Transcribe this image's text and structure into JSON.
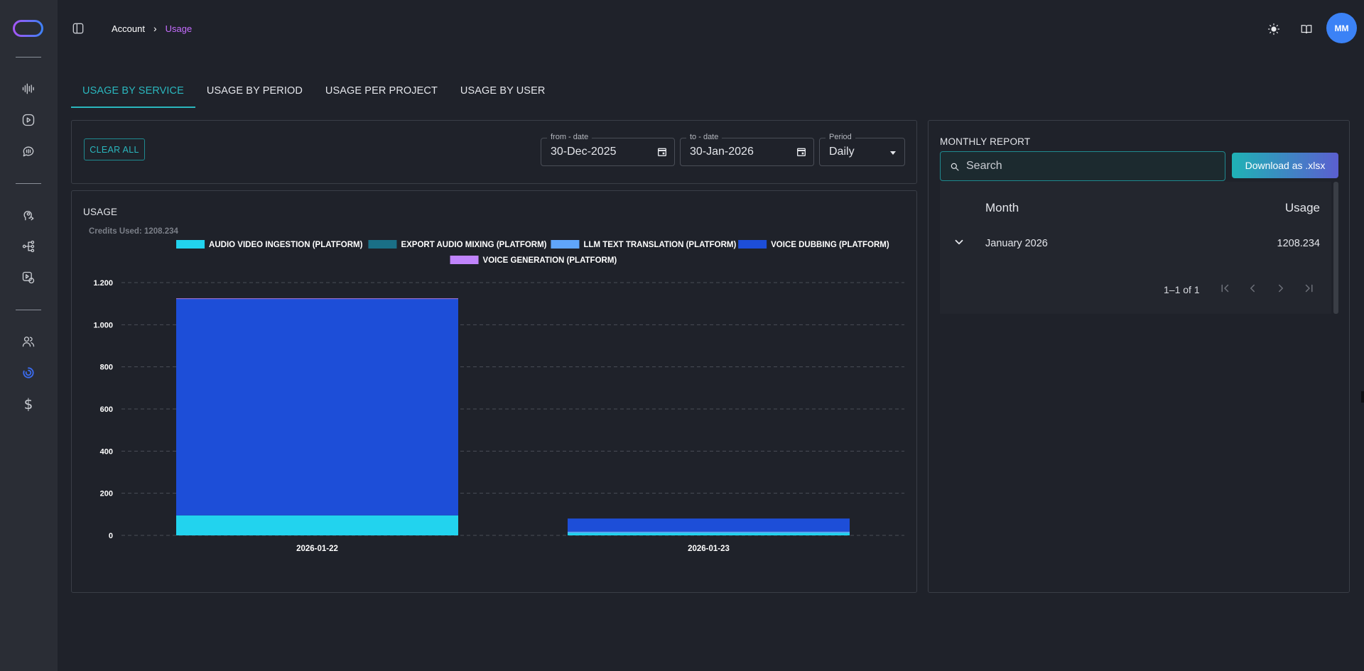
{
  "breadcrumb": {
    "account": "Account",
    "current": "Usage"
  },
  "user": {
    "initials": "MM"
  },
  "tabs": [
    {
      "label": "USAGE BY SERVICE",
      "active": true
    },
    {
      "label": "USAGE BY PERIOD",
      "active": false
    },
    {
      "label": "USAGE PER PROJECT",
      "active": false
    },
    {
      "label": "USAGE BY USER",
      "active": false
    }
  ],
  "filters": {
    "clear_label": "CLEAR ALL",
    "from_label": "from - date",
    "from_value": "30-Dec-2025",
    "to_label": "to - date",
    "to_value": "30-Jan-2026",
    "period_label": "Period",
    "period_value": "Daily"
  },
  "usage": {
    "title": "USAGE",
    "credits": "Credits Used: 1208.234"
  },
  "chart_data": {
    "type": "bar",
    "stacked": true,
    "title": "",
    "xlabel": "",
    "ylabel": "",
    "categories": [
      "2026-01-22",
      "2026-01-23"
    ],
    "ylim": [
      0,
      1200
    ],
    "yticks": [
      "0",
      "200",
      "400",
      "600",
      "800",
      "1.000",
      "1.200"
    ],
    "ytick_values": [
      0,
      200,
      400,
      600,
      800,
      1000,
      1200
    ],
    "grid": true,
    "legend_position": "top",
    "series": [
      {
        "name": "AUDIO VIDEO INGESTION (PLATFORM)",
        "color": "#22d3ee",
        "values": [
          95,
          12
        ]
      },
      {
        "name": "EXPORT AUDIO MIXING (PLATFORM)",
        "color": "#1a6f86",
        "values": [
          0,
          0
        ]
      },
      {
        "name": "LLM TEXT TRANSLATION (PLATFORM)",
        "color": "#60a5fa",
        "values": [
          0,
          6
        ]
      },
      {
        "name": "VOICE DUBBING (PLATFORM)",
        "color": "#1d4ed8",
        "values": [
          1027,
          62
        ]
      },
      {
        "name": "VOICE GENERATION (PLATFORM)",
        "color": "#c084fc",
        "values": [
          3,
          0
        ]
      }
    ]
  },
  "report": {
    "title": "MONTHLY REPORT",
    "search_placeholder": "Search",
    "download_label": "Download as .xlsx",
    "columns": {
      "month": "Month",
      "usage": "Usage"
    },
    "rows": [
      {
        "month": "January 2026",
        "usage": "1208.234"
      }
    ],
    "pagination": "1–1 of 1"
  },
  "colors": {
    "accent": "#2ab6bd",
    "breadcrumb_active": "#c56dff",
    "avatar": "#3b82f6"
  },
  "icons": {
    "sidebar": [
      "logo",
      "waveform-icon",
      "play-circle-icon",
      "chat-bubble-icon",
      "voice-profile-icon",
      "workflow-icon",
      "media-settings-icon",
      "users-icon",
      "usage-icon",
      "dollar-icon"
    ],
    "header": [
      "sidebar-toggle-icon",
      "sun-icon",
      "book-icon"
    ]
  }
}
